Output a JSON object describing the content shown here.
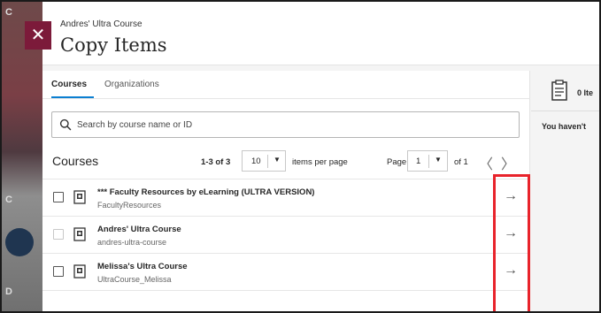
{
  "background": {
    "left_snippets": [
      "C",
      "C",
      "D"
    ]
  },
  "dialog": {
    "close_symbol": "✕",
    "subtitle": "Andres' Ultra Course",
    "title": "Copy Items"
  },
  "tabs": [
    {
      "label": "Courses",
      "active": true
    },
    {
      "label": "Organizations",
      "active": false
    }
  ],
  "search": {
    "placeholder": "Search by course name or ID",
    "value": ""
  },
  "list_header": {
    "heading": "Courses",
    "range": "1-3 of 3",
    "per_page_value": "10",
    "per_page_label": "items per page",
    "page_label": "Page",
    "page_value": "1",
    "of_label": "of 1",
    "prev_symbol": "〈",
    "next_symbol": "〉"
  },
  "courses": [
    {
      "name": "*** Faculty Resources by eLearning (ULTRA VERSION)",
      "id": "FacultyResources",
      "checkbox_enabled": true,
      "arrow": "→"
    },
    {
      "name": "Andres' Ultra Course",
      "id": "andres-ultra-course",
      "checkbox_enabled": false,
      "arrow": "→"
    },
    {
      "name": "Melissa's Ultra Course",
      "id": "UltraCourse_Melissa",
      "checkbox_enabled": true,
      "arrow": "→"
    }
  ],
  "right_panel": {
    "count_text": "0 Ite",
    "empty_text": "You haven't"
  },
  "colors": {
    "accent": "#0b7fd1",
    "close_bg": "#7c1a3a",
    "highlight": "#e8232b"
  },
  "icons": [
    "close-icon",
    "search-icon",
    "course-icon",
    "arrow-right-icon",
    "chevron-left-icon",
    "chevron-right-icon",
    "caret-down-icon",
    "clipboard-icon"
  ]
}
